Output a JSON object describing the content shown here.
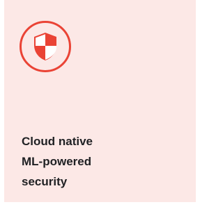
{
  "card": {
    "icon": "security-shield-icon",
    "accent_color": "#ea4335",
    "background_color": "#fce8e6",
    "title_lines": [
      "Cloud native",
      "ML-powered",
      "security"
    ]
  }
}
